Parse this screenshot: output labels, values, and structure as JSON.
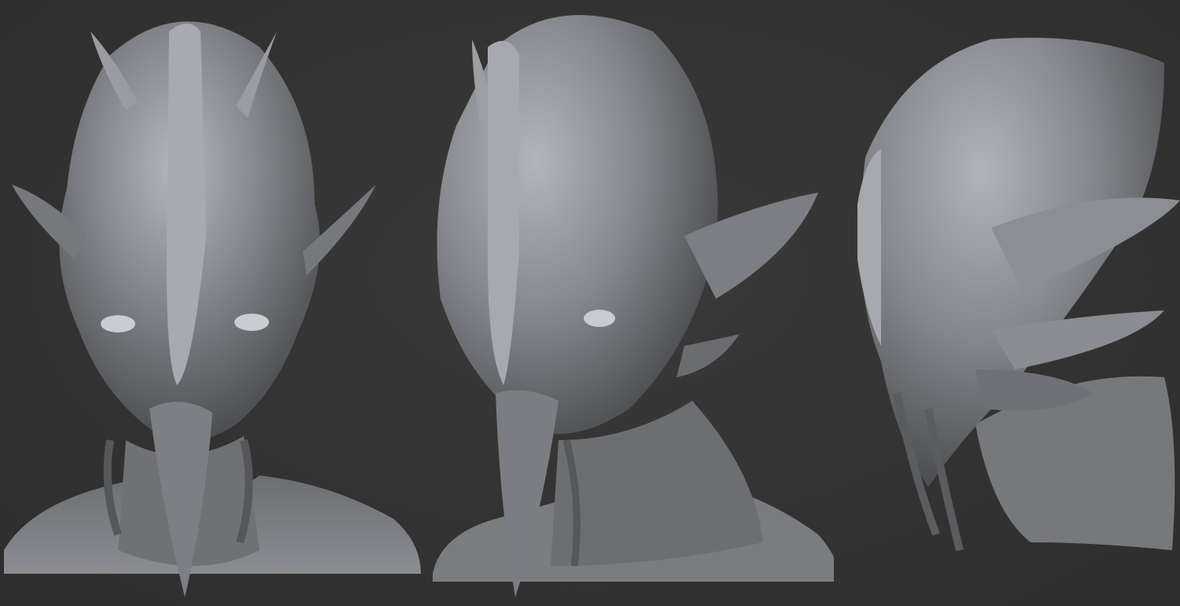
{
  "scene": {
    "background_color": "#333333",
    "material_color": "#8a8c90",
    "highlight_color": "#b9bcc2",
    "shadow_color": "#3c3d40",
    "views": [
      {
        "id": "front",
        "subject": "creature-bust-front"
      },
      {
        "id": "three-quarter",
        "subject": "creature-bust-three-quarter"
      },
      {
        "id": "side",
        "subject": "creature-bust-side"
      }
    ]
  }
}
